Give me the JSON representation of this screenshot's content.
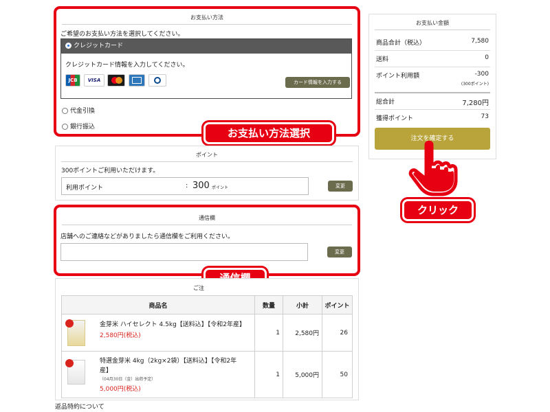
{
  "payment": {
    "section_title": "お支払い方法",
    "instruction": "ご希望のお支払い方法を選択してください。",
    "selected_option": "クレジットカード",
    "card_prompt": "クレジットカード情報を入力してください。",
    "card_brands": [
      "JCB",
      "VISA",
      "Mastercard",
      "AMERICAN EXPRESS",
      "Diners Club"
    ],
    "card_button": "カード情報を入力する",
    "option_cod": "代金引換",
    "option_bank": "銀行振込",
    "callout": "お支払い方法選択"
  },
  "points": {
    "section_title": "ポイント",
    "available_text": "300ポイントご利用いただけます。",
    "use_label": "利用ポイント",
    "separator": ":",
    "use_value": "300",
    "unit": "ポイント",
    "change_button": "変更"
  },
  "message": {
    "section_title": "通信欄",
    "instruction": "店舗へのご連絡などがありましたら通信欄をご利用ください。",
    "input_value": "",
    "change_button": "変更",
    "callout": "通信欄"
  },
  "order": {
    "section_title_partial": "ご注",
    "headers": [
      "商品名",
      "数量",
      "小計",
      "ポイント"
    ],
    "items": [
      {
        "name": "金芽米 ハイセレクト 4.5kg【送料込】【令和2年産】",
        "price": "2,580円(税込)",
        "note": "",
        "qty": "1",
        "subtotal": "2,580円",
        "points": "26"
      },
      {
        "name": "特選金芽米 4kg（2kg×2袋）【送料込】【令和2年産】",
        "price": "5,000円(税込)",
        "note": "（04月30日（金）出荷予定）",
        "qty": "1",
        "subtotal": "5,000円",
        "points": "50"
      }
    ]
  },
  "footer_link": "返品特約について",
  "summary": {
    "title": "お支払い金額",
    "rows": [
      {
        "label": "商品合計（税込）",
        "value": "7,580"
      },
      {
        "label": "送料",
        "value": "0"
      },
      {
        "label": "ポイント利用額",
        "value": "-300",
        "sub": "(300ポイント)"
      }
    ],
    "total_label": "総合計",
    "total_value": "7,280円",
    "earned_label": "獲得ポイント",
    "earned_value": "73",
    "confirm_button": "注文を確定する",
    "callout": "クリック"
  },
  "colors": {
    "accent_red": "#e60012",
    "confirm_gold": "#b8a43a",
    "dark_button": "#6b6b4e",
    "header_gray": "#595959"
  }
}
